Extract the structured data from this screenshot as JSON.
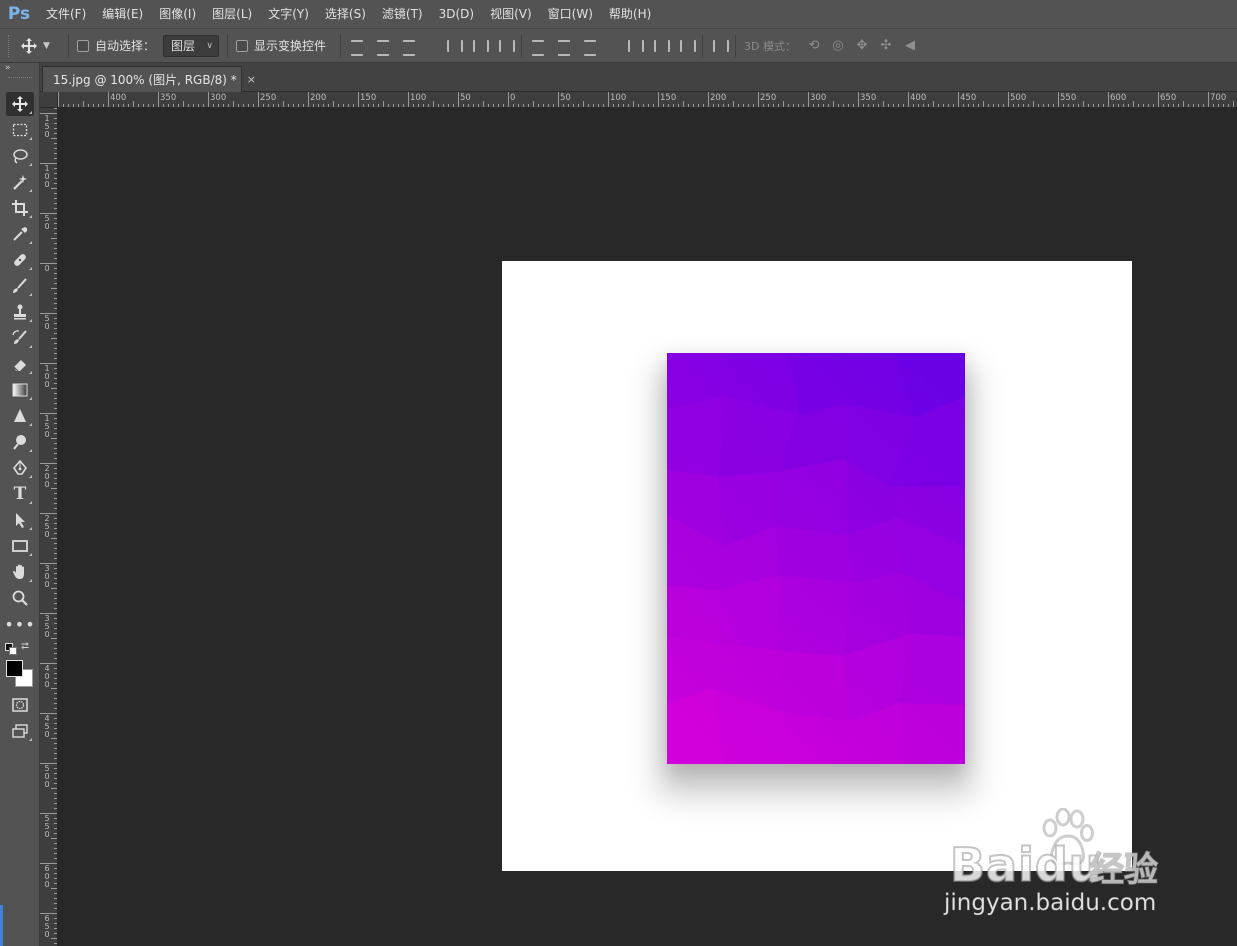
{
  "app": {
    "logo": "Ps"
  },
  "menubar": {
    "items": [
      "文件(F)",
      "编辑(E)",
      "图像(I)",
      "图层(L)",
      "文字(Y)",
      "选择(S)",
      "滤镜(T)",
      "3D(D)",
      "视图(V)",
      "窗口(W)",
      "帮助(H)"
    ]
  },
  "options": {
    "auto_select_label": "自动选择：",
    "auto_select_target": "图层",
    "show_transform_label": "显示变换控件",
    "mode3d_label": "3D 模式："
  },
  "document_tab": {
    "title": "15.jpg @ 100% (图片, RGB/8) *",
    "close_glyph": "×"
  },
  "rulers": {
    "horizontal_labels": [
      "400",
      "350",
      "300",
      "250",
      "200",
      "150",
      "100",
      "50",
      "0",
      "50",
      "100",
      "150",
      "200",
      "250",
      "300",
      "350",
      "400",
      "450",
      "500",
      "550",
      "600",
      "650",
      "700"
    ],
    "vertical_labels": [
      "150",
      "100",
      "50",
      "0",
      "50",
      "100",
      "150",
      "200",
      "250",
      "300",
      "350",
      "400",
      "450",
      "500",
      "550",
      "600",
      "650"
    ]
  },
  "artwork": {
    "gradient_top": "#6A00E6",
    "gradient_bottom": "#D400DA",
    "canvas_background": "#FFFFFF",
    "workspace_background": "#282828"
  },
  "watermark": {
    "brand": "Baidu",
    "cn_text": "经验",
    "url": "jingyan.baidu.com"
  }
}
